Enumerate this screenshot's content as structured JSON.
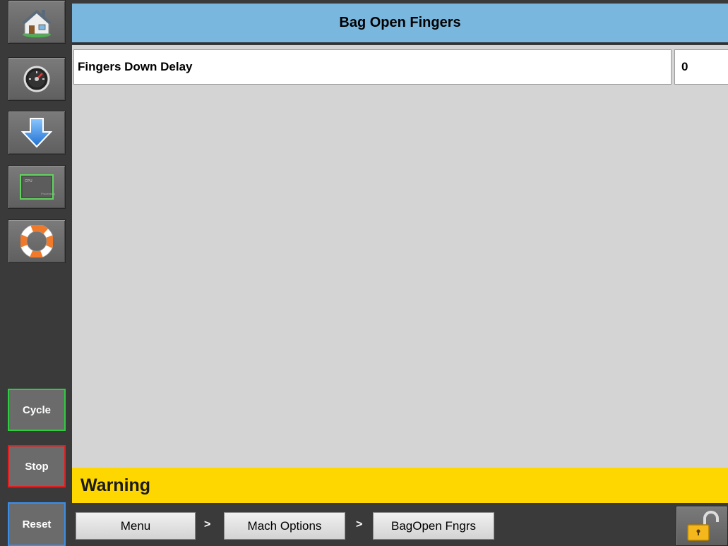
{
  "header": {
    "title": "Bag Open Fingers"
  },
  "sidebar": {
    "nav_icons": [
      "home-icon",
      "gauge-icon",
      "download-arrow-icon",
      "cpu-chip-icon",
      "life-ring-icon"
    ],
    "cycle_label": "Cycle",
    "stop_label": "Stop",
    "reset_label": "Reset"
  },
  "parameters": [
    {
      "label": "Fingers Down Delay",
      "value": "0"
    }
  ],
  "warning": {
    "text": "Warning"
  },
  "breadcrumb": {
    "items": [
      "Menu",
      "Mach Options",
      "BagOpen Fngrs"
    ],
    "separator": ">"
  },
  "lock": {
    "icon": "unlocked-padlock-icon"
  },
  "colors": {
    "header_bg": "#79b7df",
    "warning_bg": "#ffd700",
    "content_bg": "#d4d4d4",
    "sidebar_bg": "#3a3a3a",
    "cycle_border": "#2ecc40",
    "stop_border": "#e02020",
    "reset_border": "#3a8ee6"
  }
}
